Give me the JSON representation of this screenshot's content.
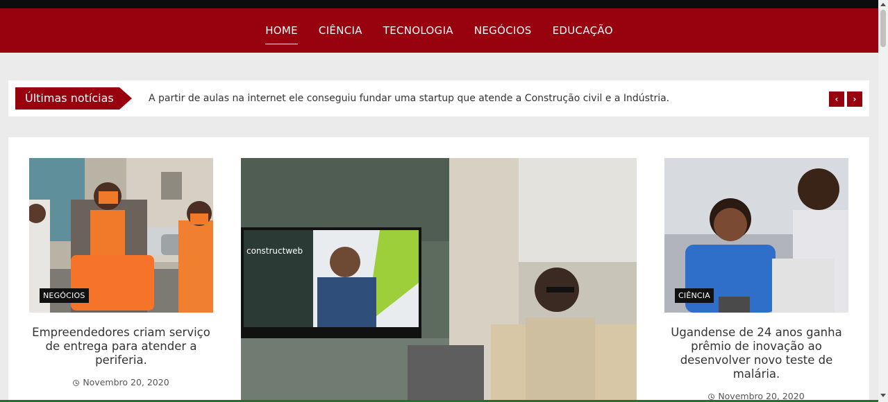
{
  "nav": {
    "items": [
      {
        "label": "HOME",
        "active": true
      },
      {
        "label": "CIÊNCIA"
      },
      {
        "label": "TECNOLOGIA"
      },
      {
        "label": "NEGÓCIOS"
      },
      {
        "label": "EDUCAÇÃO"
      }
    ]
  },
  "ticker": {
    "label": "Últimas notícias",
    "text": "A partir de aulas na internet ele conseguiu fundar uma startup que atende a Construção civil e a Indústria.",
    "prev_icon": "‹",
    "next_icon": "›"
  },
  "cards": [
    {
      "category": "NEGÓCIOS",
      "title": "Empreendedores criam serviço de entrega para atender a periferia.",
      "date": "Novembro 20, 2020"
    },
    {
      "screen_brand": "constructweb"
    },
    {
      "category": "CIÊNCIA",
      "title": "Ugandense de 24 anos ganha prêmio de inovação ao desenvolver novo teste de malária.",
      "date": "Novembro 20, 2020"
    }
  ],
  "colors": {
    "brand": "#98020e",
    "topbar": "#0c0c0c",
    "page_bg": "#ebebeb"
  }
}
